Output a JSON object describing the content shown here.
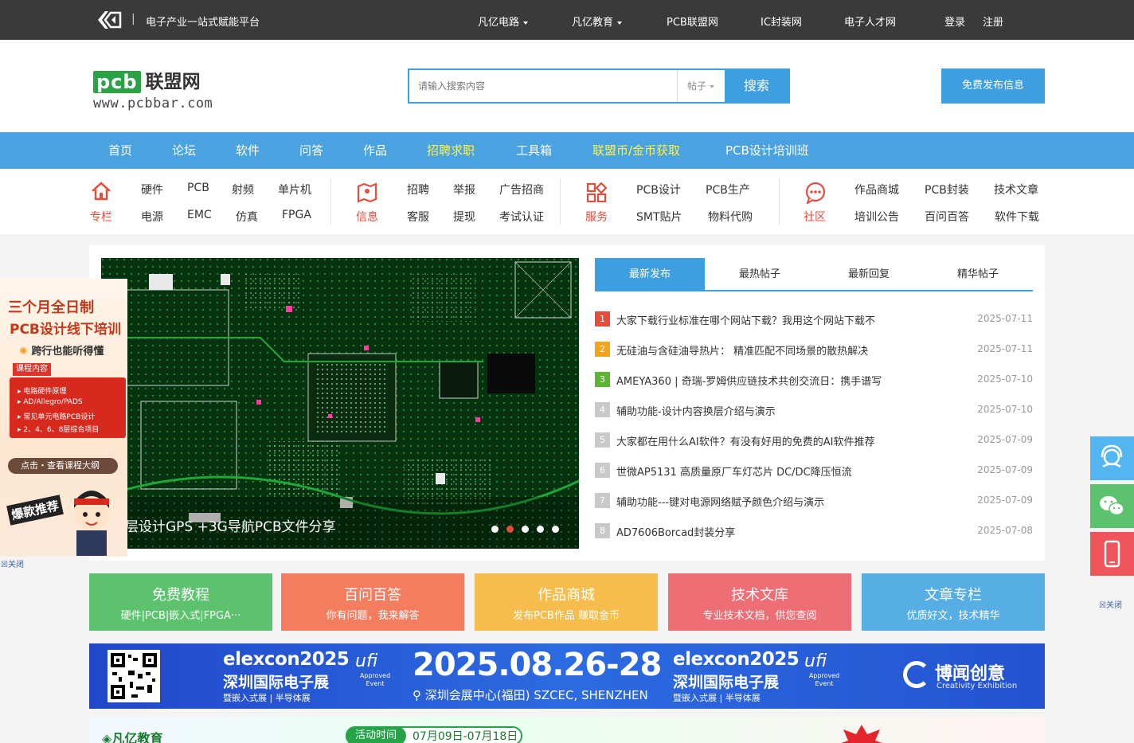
{
  "topbar": {
    "slogan": "电子产业一站式赋能平台",
    "links": [
      "凡亿电路",
      "凡亿教育",
      "PCB联盟网",
      "IC封装网",
      "电子人才网"
    ],
    "login": "登录",
    "register": "注册"
  },
  "header": {
    "brand_pcb": "pcb",
    "brand_cn": "联盟网",
    "brand_url": "www.pcbbar.com",
    "search_placeholder": "请输入搜索内容",
    "search_type": "帖子",
    "search_button": "搜索",
    "publish_button": "免费发布信息"
  },
  "mainnav": [
    "首页",
    "论坛",
    "软件",
    "问答",
    "作品",
    "招聘求职",
    "工具箱",
    "联盟币/金币获取",
    "PCB设计培训班"
  ],
  "subnav": {
    "groups": [
      {
        "label": "专栏",
        "links": [
          "硬件",
          "PCB",
          "射频",
          "单片机",
          "电源",
          "EMC",
          "仿真",
          "FPGA"
        ]
      },
      {
        "label": "信息",
        "links": [
          "招聘",
          "举报",
          "广告招商",
          "客服",
          "提现",
          "考试认证"
        ]
      },
      {
        "label": "服务",
        "links": [
          "PCB设计",
          "PCB生产",
          "SMT贴片",
          "物料代购"
        ]
      },
      {
        "label": "社区",
        "links": [
          "作品商城",
          "PCB封装",
          "技术文章",
          "培训公告",
          "百问百答",
          "软件下载"
        ]
      }
    ]
  },
  "slider": {
    "caption": "层设计GPS +3G导航PCB文件分享",
    "dots": 5,
    "active_dot": 2
  },
  "tabs": [
    "最新发布",
    "最热帖子",
    "最新回复",
    "精华帖子"
  ],
  "posts": [
    {
      "num": "1",
      "title": "大家下载行业标准在哪个网站下载？我用这个网站下载不",
      "date": "2025-07-11"
    },
    {
      "num": "2",
      "title": "无硅油与含硅油导热片：  精准匹配不同场景的散热解决",
      "date": "2025-07-11"
    },
    {
      "num": "3",
      "title": "AMEYA360 | 奇瑞-罗姆供应链技术共创交流日：携手谱写",
      "date": "2025-07-10"
    },
    {
      "num": "4",
      "title": "辅助功能-设计内容换层介绍与演示",
      "date": "2025-07-10"
    },
    {
      "num": "5",
      "title": "大家都在用什么AI软件？有没有好用的免费的AI软件推荐",
      "date": "2025-07-09"
    },
    {
      "num": "6",
      "title": "世微AP5131 高质量原厂车灯芯片 DC/DC降压恒流",
      "date": "2025-07-09"
    },
    {
      "num": "7",
      "title": "辅助功能---键对电源网络赋予颜色介绍与演示",
      "date": "2025-07-09"
    },
    {
      "num": "8",
      "title": "AD7606Borcad封装分享",
      "date": "2025-07-08"
    }
  ],
  "tiles": [
    {
      "title": "免费教程",
      "sub": "硬件|PCB|嵌入式|FPGA···",
      "color": "#5cc26e"
    },
    {
      "title": "百问百答",
      "sub": "你有问题，我来解答",
      "color": "#f47c5f"
    },
    {
      "title": "作品商城",
      "sub": "发布PCB作品 赚取金币",
      "color": "#f6bd4c"
    },
    {
      "title": "技术文库",
      "sub": "专业技术文档，供您查阅",
      "color": "#ee6e75"
    },
    {
      "title": "文章专栏",
      "sub": "优质好文，技术精华",
      "color": "#57aee5"
    }
  ],
  "banner": {
    "brand1": "elexcon2025",
    "name1": "深圳国际电子展",
    "tags1": "暨嵌入式展 | 半导体展",
    "ufi": "ufi",
    "ufi_sub": "Approved Event",
    "date": "2025.08.26-28",
    "venue": "深圳会展中心(福田) SZCEC, SHENZHEN",
    "brand2": "elexcon2025",
    "name2": "深圳国际电子展",
    "tags2": "暨嵌入式展 | 半导体展",
    "org": "博闻创意",
    "org_sub": "Creativity Exhibition"
  },
  "banner2": {
    "brand": "凡亿教育",
    "label": "活动时间",
    "dates": "07月09日-07月18日"
  },
  "leftad": {
    "line1": "三个月全日制",
    "line2": "PCB设计线下培训",
    "line3": "跨行也能听得懂",
    "course_label": "课程内容",
    "items": [
      "电路硬件原理",
      "AD/Allegro/PADS",
      "常见单元电路PCB设计",
      "2、4、6、8层综合项目"
    ],
    "cta": "点击・查看课程大纲",
    "badge": "爆款推荐"
  },
  "close_left": "关闭",
  "close_right": "关闭",
  "colors": {
    "accent": "#3d9ee0",
    "topbar": "#3a3a3a",
    "highlight": "#fff34a",
    "red": "#e44c3c"
  }
}
